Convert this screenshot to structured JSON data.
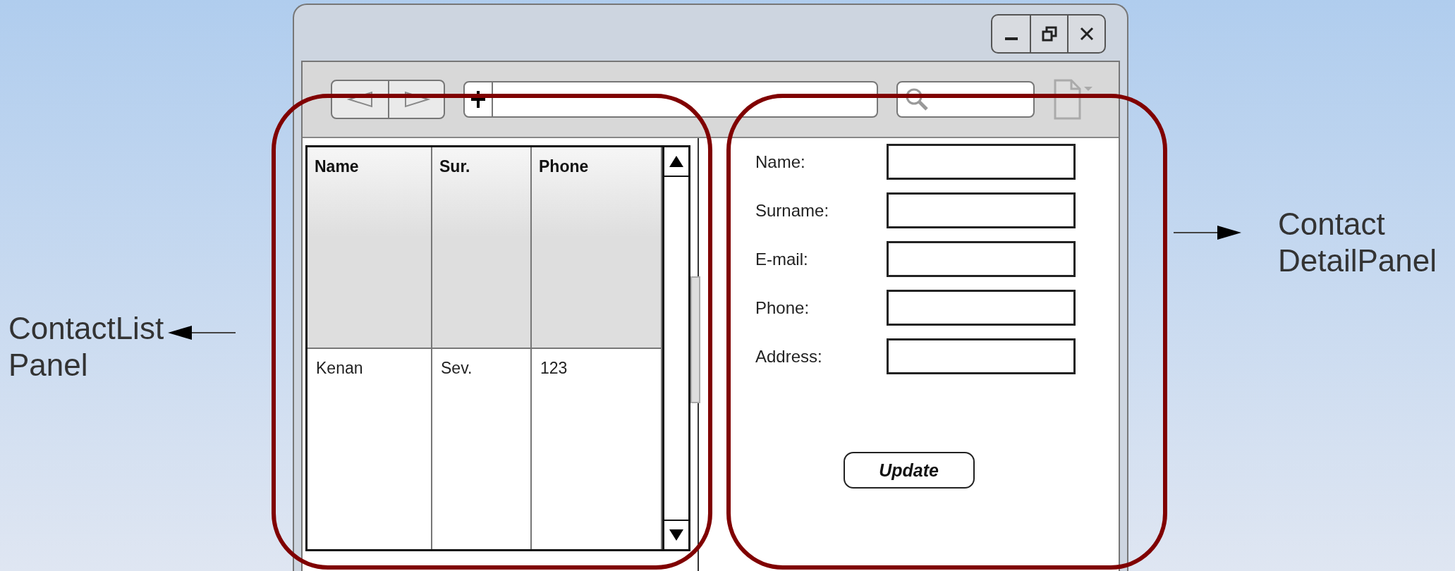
{
  "left_annotation": {
    "text": "ContactList\nPanel"
  },
  "right_annotation": {
    "text": "Contact\nDetailPanel"
  },
  "contact_list": {
    "columns": [
      "Name",
      "Sur.",
      "Phone"
    ],
    "rows": [
      [
        "Kenan",
        "Sev.",
        "123"
      ]
    ]
  },
  "contact_detail": {
    "fields": [
      {
        "label": "Name:"
      },
      {
        "label": "Surname:"
      },
      {
        "label": "E-mail:"
      },
      {
        "label": "Phone:"
      },
      {
        "label": "Address:"
      }
    ],
    "button": "Update"
  }
}
